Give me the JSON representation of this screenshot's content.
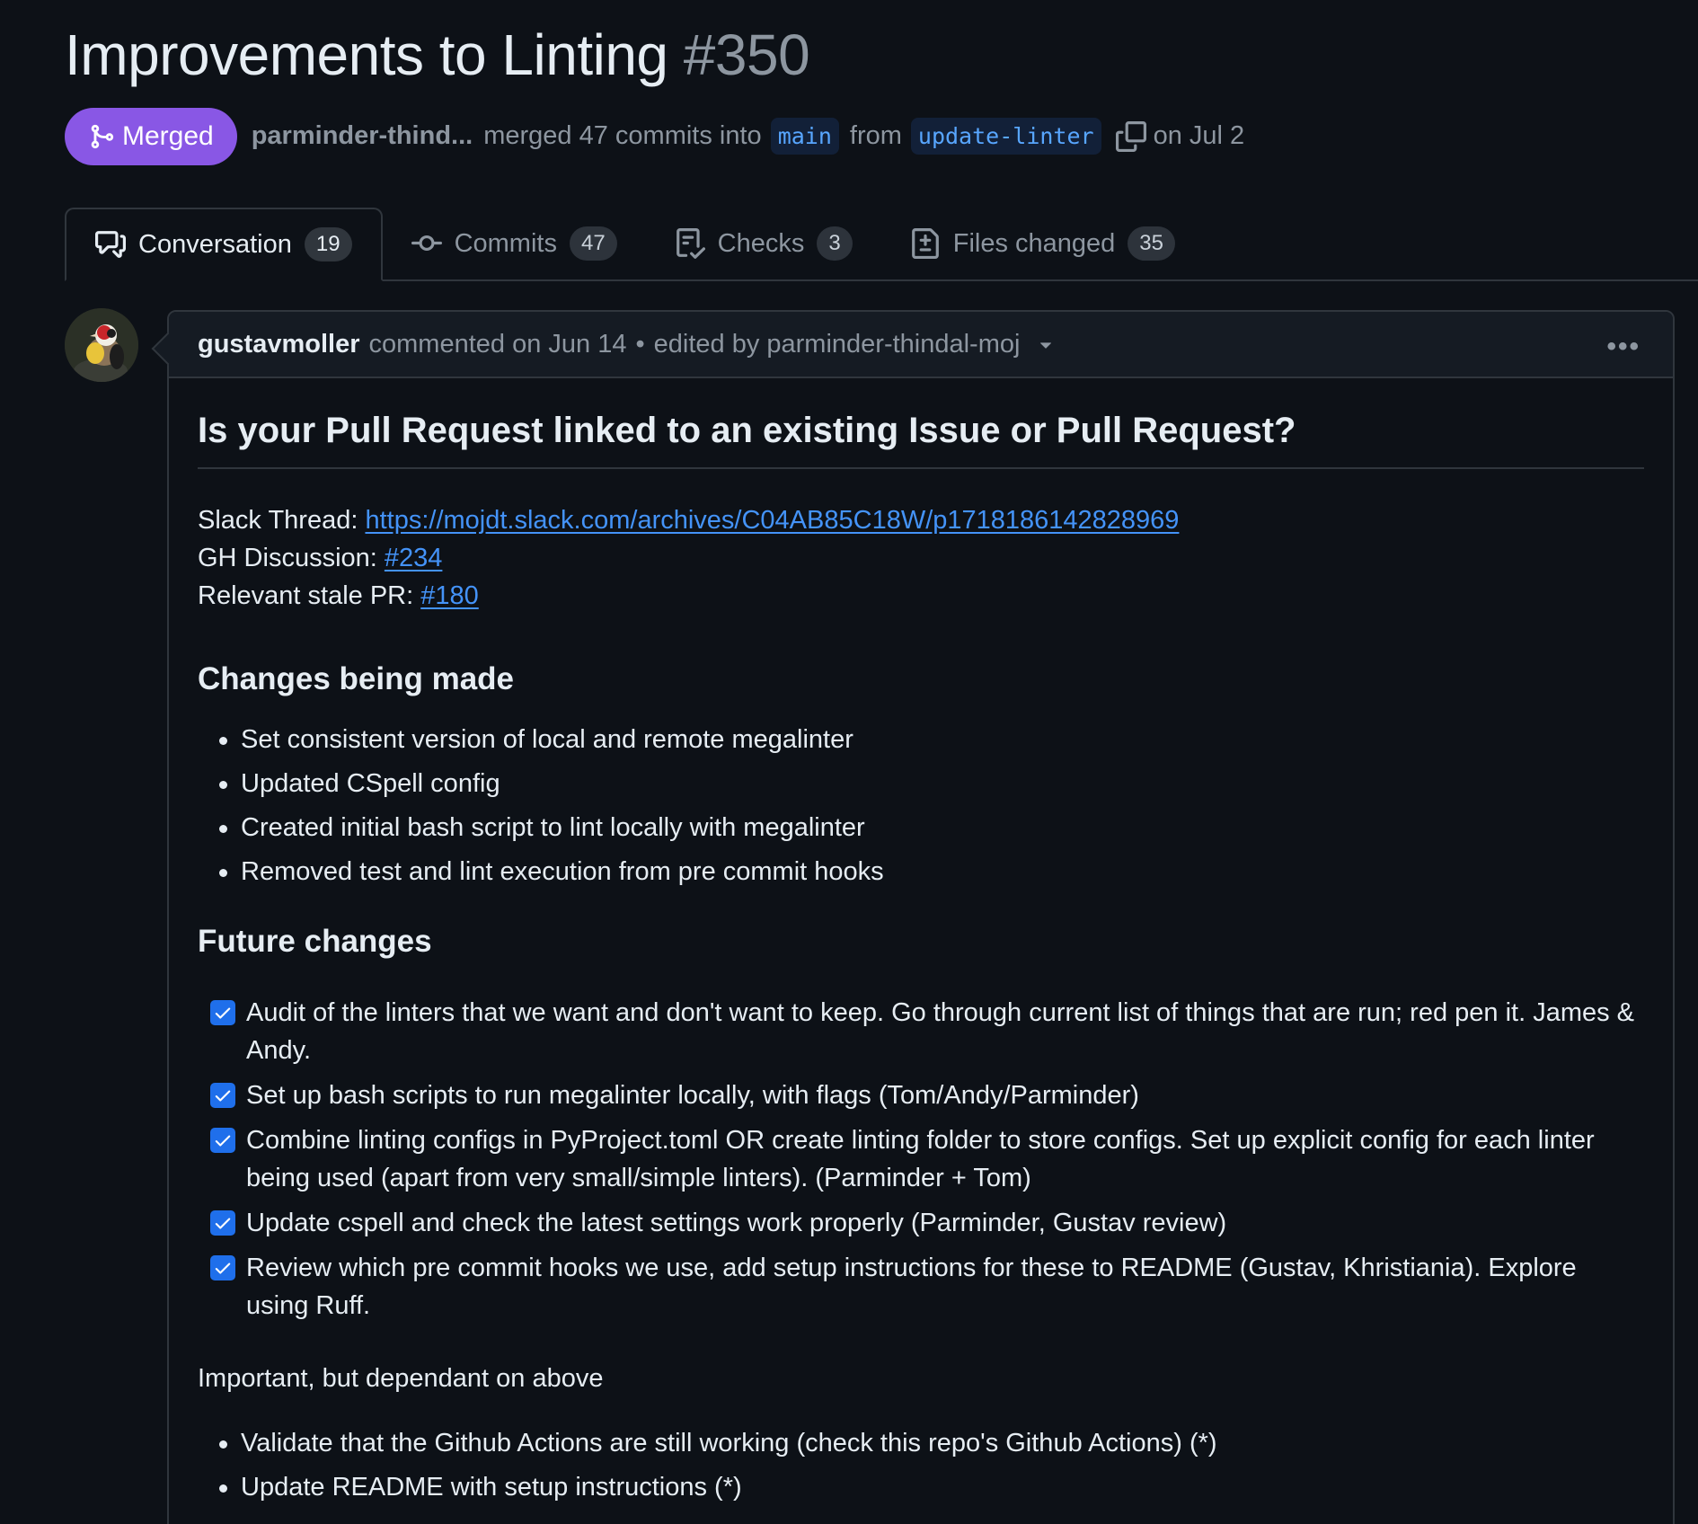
{
  "pr": {
    "title": "Improvements to Linting",
    "number": "#350",
    "status": "Merged",
    "author": "parminder-thind...",
    "merged_text": "merged 47 commits into",
    "base_branch": "main",
    "from_text": "from",
    "head_branch": "update-linter",
    "date_text": "on Jul 2"
  },
  "tabs": [
    {
      "label": "Conversation",
      "count": "19",
      "icon": "comment-discussion-icon"
    },
    {
      "label": "Commits",
      "count": "47",
      "icon": "git-commit-icon"
    },
    {
      "label": "Checks",
      "count": "3",
      "icon": "checklist-icon"
    },
    {
      "label": "Files changed",
      "count": "35",
      "icon": "file-diff-icon"
    }
  ],
  "comment": {
    "author": "gustavmoller",
    "action": "commented on Jun 14",
    "separator": "•",
    "edited_by": "edited by parminder-thindal-moj",
    "heading": "Is your Pull Request linked to an existing Issue or Pull Request?",
    "links": [
      {
        "label": "Slack Thread:",
        "value": "https://mojdt.slack.com/archives/C04AB85C18W/p1718186142828969"
      },
      {
        "label": "GH Discussion:",
        "value": "#234"
      },
      {
        "label": "Relevant stale PR:",
        "value": "#180"
      }
    ],
    "changes_heading": "Changes being made",
    "changes": [
      "Set consistent version of local and remote megalinter",
      "Updated CSpell config",
      "Created initial bash script to lint locally with megalinter",
      "Removed test and lint execution from pre commit hooks"
    ],
    "future_heading": "Future changes",
    "tasks": [
      {
        "text": "Audit of the linters that we want and don't want to keep. Go through current list of things that are run; red pen it. James & Andy.",
        "checked": true
      },
      {
        "text": "Set up bash scripts to run megalinter locally, with flags (Tom/Andy/Parminder)",
        "checked": true
      },
      {
        "text": "Combine linting configs in PyProject.toml OR create linting folder to store configs. Set up explicit config for each linter being used (apart from very small/simple linters). (Parminder + Tom)",
        "checked": true
      },
      {
        "text": "Update cspell and check the latest settings work properly (Parminder, Gustav review)",
        "checked": true
      },
      {
        "text": "Review which pre commit hooks we use, add setup instructions for these to README (Gustav, Khristiania). Explore using Ruff.",
        "checked": true
      }
    ],
    "important_text": "Important, but dependant on above",
    "important_items": [
      "Validate that the Github Actions are still working (check this repo's Github Actions) (*)",
      "Update README with setup instructions (*)"
    ]
  },
  "colors": {
    "background": "#0d1117",
    "merged": "#8957e5",
    "link": "#4493f8",
    "checkbox": "#1f6feb"
  }
}
